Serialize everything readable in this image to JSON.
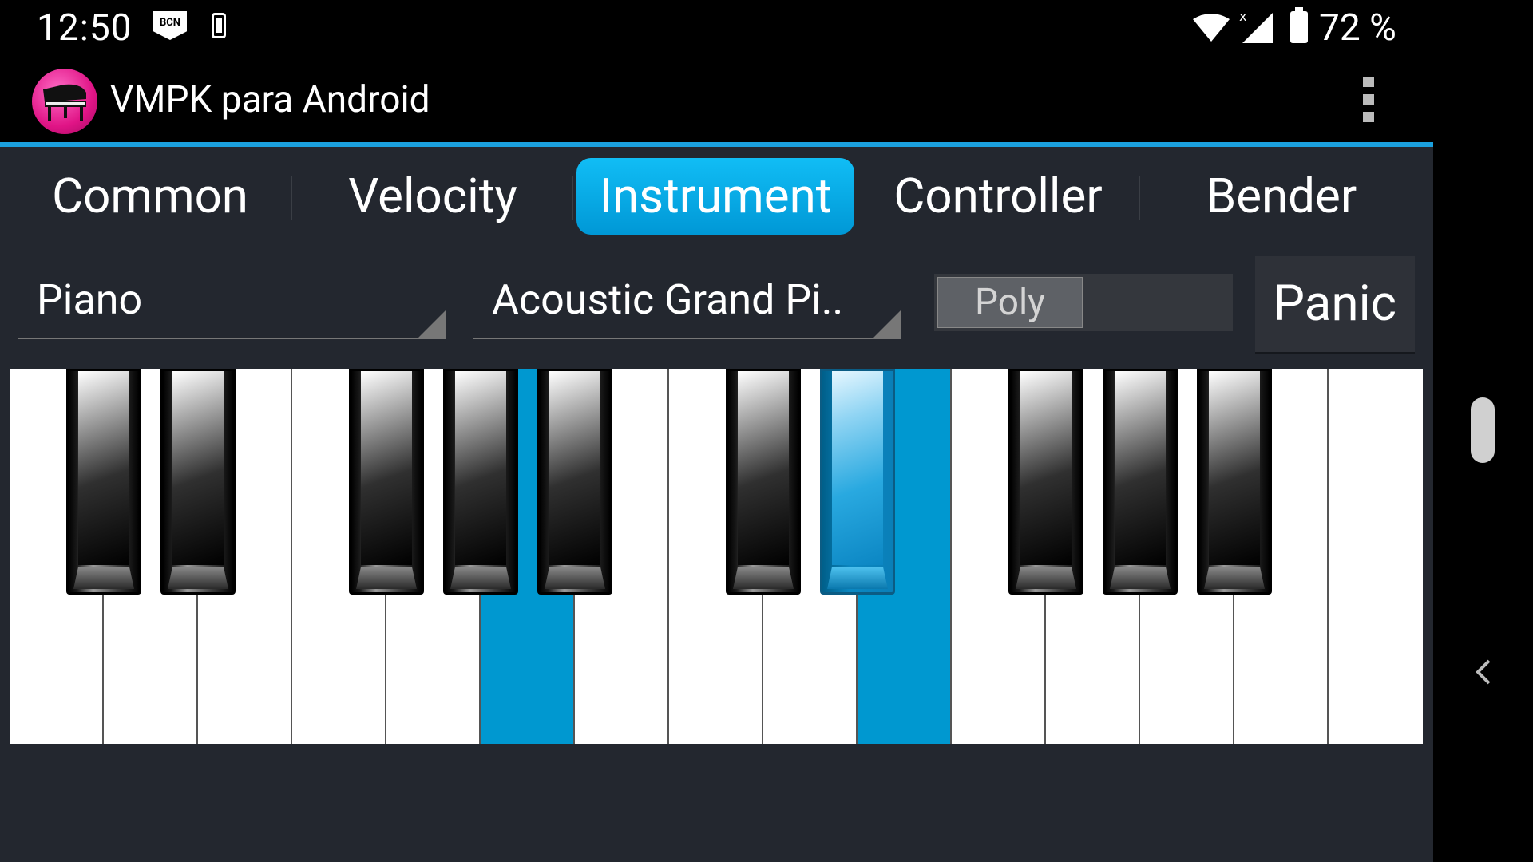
{
  "status_bar": {
    "time": "12:50",
    "carrier_badge": "BCN",
    "battery_percent": "72 %",
    "icons": [
      "bcn-badge-icon",
      "phone-vibrate-icon",
      "wifi-icon",
      "signal-icon",
      "battery-icon"
    ]
  },
  "app_bar": {
    "title": "VMPK para Android",
    "icon": "grand-piano-icon",
    "accent_color": "#1ba0de"
  },
  "tabs": [
    {
      "label": "Common",
      "active": false
    },
    {
      "label": "Velocity",
      "active": false
    },
    {
      "label": "Instrument",
      "active": true
    },
    {
      "label": "Controller",
      "active": false
    },
    {
      "label": "Bender",
      "active": false
    }
  ],
  "controls": {
    "bank_selected": "Piano",
    "program_selected": "Acoustic Grand Pi..",
    "poly_toggle_label": "Poly",
    "panic_label": "Panic"
  },
  "keyboard": {
    "white_keys": 15,
    "pressed_white_keys": [
      5,
      9
    ],
    "pressed_black_keys": [
      6
    ],
    "pressed_color": "#0098d0"
  },
  "nav_bar": {
    "icons": [
      "home-pill-icon",
      "back-chevron-icon"
    ]
  }
}
